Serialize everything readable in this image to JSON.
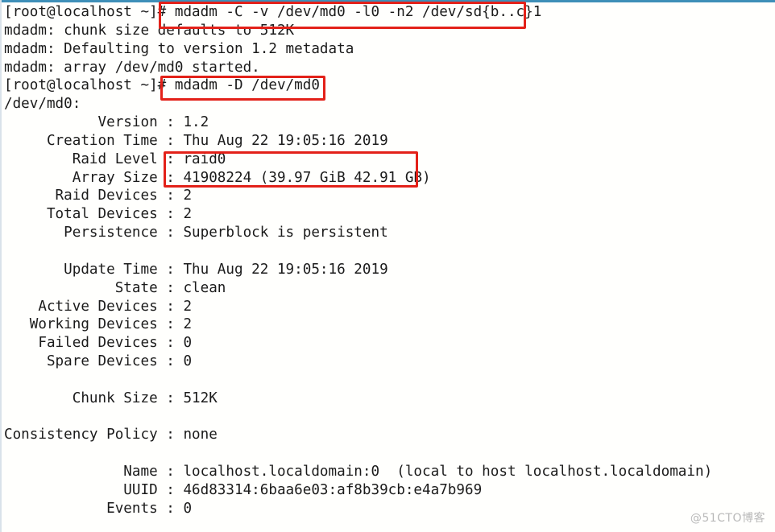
{
  "terminal": {
    "prompt": "[root@localhost ~]#",
    "lines": [
      "[root@localhost ~]# mdadm -C -v /dev/md0 -l0 -n2 /dev/sd{b..c}1",
      "mdadm: chunk size defaults to 512K",
      "mdadm: Defaulting to version 1.2 metadata",
      "mdadm: array /dev/md0 started.",
      "[root@localhost ~]# mdadm -D /dev/md0",
      "/dev/md0:",
      "           Version : 1.2",
      "     Creation Time : Thu Aug 22 19:05:16 2019",
      "        Raid Level : raid0",
      "        Array Size : 41908224 (39.97 GiB 42.91 GB)",
      "      Raid Devices : 2",
      "     Total Devices : 2",
      "       Persistence : Superblock is persistent",
      "",
      "       Update Time : Thu Aug 22 19:05:16 2019",
      "             State : clean",
      "    Active Devices : 2",
      "   Working Devices : 2",
      "    Failed Devices : 0",
      "     Spare Devices : 0",
      "",
      "        Chunk Size : 512K",
      "",
      "Consistency Policy : none",
      "",
      "              Name : localhost.localdomain:0  (local to host localhost.localdomain)",
      "              UUID : 46d83314:6baa6e03:af8b39cb:e4a7b969",
      "            Events : 0"
    ],
    "commands": {
      "create_array": "mdadm -C -v /dev/md0 -l0 -n2 /dev/sd{b..c}1",
      "detail_array": "mdadm -D /dev/md0"
    },
    "mdadm_messages": {
      "chunk_size": "mdadm: chunk size defaults to 512K",
      "metadata_version": "mdadm: Defaulting to version 1.2 metadata",
      "array_started": "mdadm: array /dev/md0 started."
    },
    "array_detail": {
      "device": "/dev/md0:",
      "fields": [
        {
          "label": "Version",
          "value": "1.2"
        },
        {
          "label": "Creation Time",
          "value": "Thu Aug 22 19:05:16 2019"
        },
        {
          "label": "Raid Level",
          "value": "raid0"
        },
        {
          "label": "Array Size",
          "value": "41908224 (39.97 GiB 42.91 GB)"
        },
        {
          "label": "Raid Devices",
          "value": "2"
        },
        {
          "label": "Total Devices",
          "value": "2"
        },
        {
          "label": "Persistence",
          "value": "Superblock is persistent"
        },
        {
          "label": "Update Time",
          "value": "Thu Aug 22 19:05:16 2019"
        },
        {
          "label": "State",
          "value": "clean"
        },
        {
          "label": "Active Devices",
          "value": "2"
        },
        {
          "label": "Working Devices",
          "value": "2"
        },
        {
          "label": "Failed Devices",
          "value": "0"
        },
        {
          "label": "Spare Devices",
          "value": "0"
        },
        {
          "label": "Chunk Size",
          "value": "512K"
        },
        {
          "label": "Consistency Policy",
          "value": "none"
        },
        {
          "label": "Name",
          "value": "localhost.localdomain:0  (local to host localhost.localdomain)"
        },
        {
          "label": "UUID",
          "value": "46d83314:6baa6e03:af8b39cb:e4a7b969"
        },
        {
          "label": "Events",
          "value": "0"
        }
      ]
    }
  },
  "annotations": {
    "color": "#e32119",
    "boxes": [
      {
        "name": "create-command",
        "target": "mdadm -C -v /dev/md0 -l0 -n2 /dev/sd{b..c}1"
      },
      {
        "name": "detail-command",
        "target": "mdadm -D /dev/md0"
      },
      {
        "name": "raid-level-and-size",
        "target": "raid0 / 41908224 (39.97 GiB 42.91 GB)"
      }
    ]
  },
  "watermark": {
    "text": "@51CTO博客"
  }
}
